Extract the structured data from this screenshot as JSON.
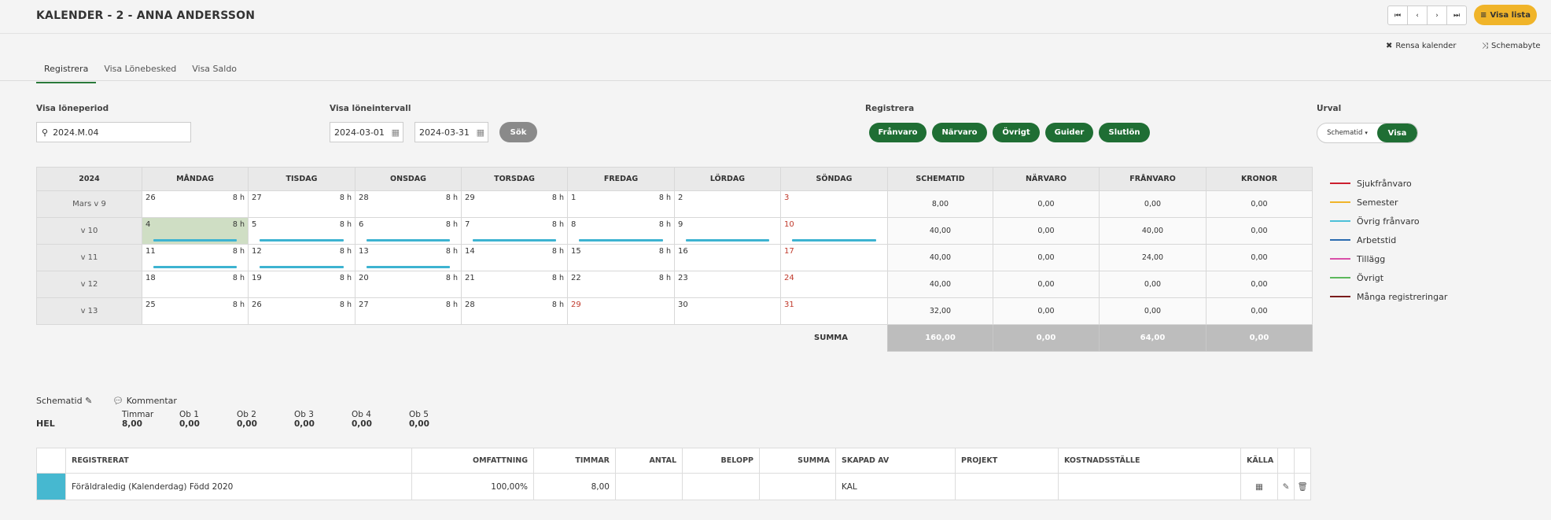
{
  "header": {
    "title": "KALENDER - 2 - ANNA ANDERSSON",
    "visa_lista": "Visa lista",
    "rensa": "Rensa kalender",
    "schemabyte": "Schemabyte"
  },
  "tabs": [
    "Registrera",
    "Visa Lönebesked",
    "Visa Saldo"
  ],
  "filters": {
    "loneperiod_label": "Visa löneperiod",
    "loneperiod_value": "2024.M.04",
    "intervall_label": "Visa löneintervall",
    "from": "2024-03-01",
    "to": "2024-03-31",
    "sok": "Sök",
    "registrera_label": "Registrera",
    "registrera_buttons": [
      "Frånvaro",
      "Närvaro",
      "Övrigt",
      "Guider",
      "Slutlön"
    ],
    "urval_label": "Urval",
    "urval_select": "Schematid",
    "urval_visa": "Visa"
  },
  "calendar": {
    "headers": [
      "2024",
      "MÅNDAG",
      "TISDAG",
      "ONSDAG",
      "TORSDAG",
      "FREDAG",
      "LÖRDAG",
      "SÖNDAG",
      "SCHEMATID",
      "NÄRVARO",
      "FRÅNVARO",
      "KRONOR"
    ],
    "weeks": [
      {
        "label": "Mars v 9",
        "days": [
          [
            "26",
            "8 h"
          ],
          [
            "27",
            "8 h"
          ],
          [
            "28",
            "8 h"
          ],
          [
            "29",
            "8 h"
          ],
          [
            "1",
            "8 h"
          ],
          [
            "2",
            ""
          ],
          [
            "3",
            ""
          ]
        ],
        "sums": [
          "8,00",
          "0,00",
          "0,00",
          "0,00"
        ]
      },
      {
        "label": "v 10",
        "days": [
          [
            "4",
            "8 h"
          ],
          [
            "5",
            "8 h"
          ],
          [
            "6",
            "8 h"
          ],
          [
            "7",
            "8 h"
          ],
          [
            "8",
            "8 h"
          ],
          [
            "9",
            ""
          ],
          [
            "10",
            ""
          ]
        ],
        "sums": [
          "40,00",
          "0,00",
          "40,00",
          "0,00"
        ]
      },
      {
        "label": "v 11",
        "days": [
          [
            "11",
            "8 h"
          ],
          [
            "12",
            "8 h"
          ],
          [
            "13",
            "8 h"
          ],
          [
            "14",
            "8 h"
          ],
          [
            "15",
            "8 h"
          ],
          [
            "16",
            ""
          ],
          [
            "17",
            ""
          ]
        ],
        "sums": [
          "40,00",
          "0,00",
          "24,00",
          "0,00"
        ]
      },
      {
        "label": "v 12",
        "days": [
          [
            "18",
            "8 h"
          ],
          [
            "19",
            "8 h"
          ],
          [
            "20",
            "8 h"
          ],
          [
            "21",
            "8 h"
          ],
          [
            "22",
            "8 h"
          ],
          [
            "23",
            ""
          ],
          [
            "24",
            ""
          ]
        ],
        "sums": [
          "40,00",
          "0,00",
          "0,00",
          "0,00"
        ]
      },
      {
        "label": "v 13",
        "days": [
          [
            "25",
            "8 h"
          ],
          [
            "26",
            "8 h"
          ],
          [
            "27",
            "8 h"
          ],
          [
            "28",
            "8 h"
          ],
          [
            "29",
            ""
          ],
          [
            "30",
            ""
          ],
          [
            "31",
            ""
          ]
        ],
        "sums": [
          "32,00",
          "0,00",
          "0,00",
          "0,00"
        ]
      }
    ],
    "summa_label": "SUMMA",
    "totals": [
      "160,00",
      "0,00",
      "64,00",
      "0,00"
    ]
  },
  "legend": [
    {
      "label": "Sjukfrånvaro",
      "color": "#cc1f2f"
    },
    {
      "label": "Semester",
      "color": "#f0b429"
    },
    {
      "label": "Övrig frånvaro",
      "color": "#4cc0d8"
    },
    {
      "label": "Arbetstid",
      "color": "#2b6cb0"
    },
    {
      "label": "Tillägg",
      "color": "#d94fa8"
    },
    {
      "label": "Övrigt",
      "color": "#5cb85c"
    },
    {
      "label": "Många registreringar",
      "color": "#7a1c1c"
    }
  ],
  "schedule": {
    "schematid": "Schematid",
    "kommentar": "Kommentar",
    "type": "HEL",
    "cols": [
      [
        "Timmar",
        "8,00"
      ],
      [
        "Ob 1",
        "0,00"
      ],
      [
        "Ob 2",
        "0,00"
      ],
      [
        "Ob 3",
        "0,00"
      ],
      [
        "Ob 4",
        "0,00"
      ],
      [
        "Ob 5",
        "0,00"
      ]
    ]
  },
  "registrations": {
    "headers": [
      "REGISTRERAT",
      "OMFATTNING",
      "TIMMAR",
      "ANTAL",
      "BELOPP",
      "SUMMA",
      "SKAPAD AV",
      "PROJEKT",
      "KOSTNADSSTÄLLE",
      "KÄLLA"
    ],
    "rows": [
      {
        "registrerat": "Föräldraledig (Kalenderdag) Född 2020",
        "omfattning": "100,00%",
        "timmar": "8,00",
        "antal": "",
        "belopp": "",
        "summa": "",
        "skapad_av": "KAL",
        "projekt": "",
        "kostnadsstalle": "",
        "kalla": ""
      }
    ]
  }
}
